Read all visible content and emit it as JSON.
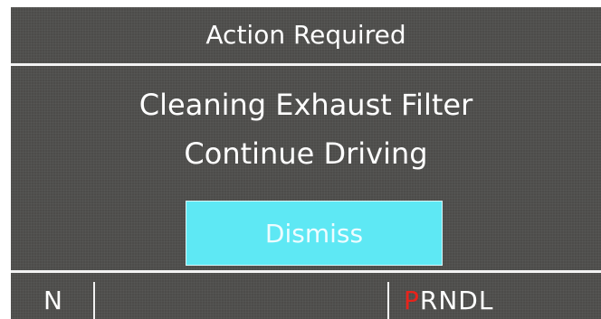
{
  "header": {
    "title": "Action Required"
  },
  "message": {
    "line1": "Cleaning Exhaust Filter",
    "line2": "Continue Driving"
  },
  "dismiss_label": "Dismiss",
  "status_bar": {
    "gear_left": "N",
    "gear_selector": {
      "active": "P",
      "rest": "RNDL",
      "active_color": "#e8231b"
    }
  },
  "colors": {
    "background": "#4d4c4a",
    "button": "#5ee8f4",
    "text": "#ffffff"
  }
}
